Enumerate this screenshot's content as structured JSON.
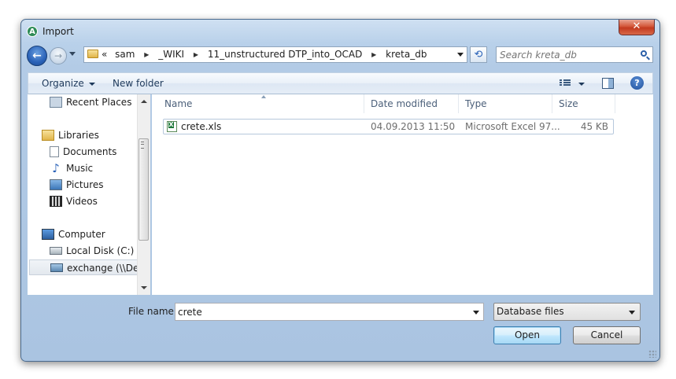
{
  "window": {
    "title": "Import",
    "close_glyph": "✕"
  },
  "nav": {
    "back_glyph": "←",
    "forward_glyph": "→",
    "breadcrumb": [
      "«",
      "sam",
      "_WIKI",
      "11_unstructured DTP_into_OCAD",
      "kreta_db"
    ],
    "separator_glyph": "▶",
    "refresh_glyph": "⟲",
    "search_placeholder": "Search kreta_db"
  },
  "toolbar": {
    "organize_label": "Organize",
    "new_folder_label": "New folder",
    "help_glyph": "?"
  },
  "sidebar": {
    "items": [
      {
        "label": "Recent Places",
        "icon": "recent-places-icon"
      },
      {
        "label": "Libraries",
        "icon": "libraries-icon"
      },
      {
        "label": "Documents",
        "icon": "documents-icon"
      },
      {
        "label": "Music",
        "icon": "music-icon"
      },
      {
        "label": "Pictures",
        "icon": "pictures-icon"
      },
      {
        "label": "Videos",
        "icon": "videos-icon"
      },
      {
        "label": "Computer",
        "icon": "computer-icon"
      },
      {
        "label": "Local Disk (C:)",
        "icon": "local-disk-icon"
      },
      {
        "label": "exchange (\\\\Dells",
        "icon": "network-drive-icon",
        "selected": true
      }
    ]
  },
  "files": {
    "columns": [
      "Name",
      "Date modified",
      "Type",
      "Size"
    ],
    "rows": [
      {
        "name": "crete.xls",
        "date": "04.09.2013 11:50",
        "type": "Microsoft Excel 97...",
        "size": "45 KB"
      }
    ]
  },
  "footer": {
    "file_name_label": "File name:",
    "file_name_value": "crete",
    "file_type_value": "Database files",
    "open_label": "Open",
    "cancel_label": "Cancel"
  },
  "colors": {
    "frame": "#b9d1ea",
    "selection_border": "#b6c8dc",
    "close_red": "#c33a1f"
  }
}
